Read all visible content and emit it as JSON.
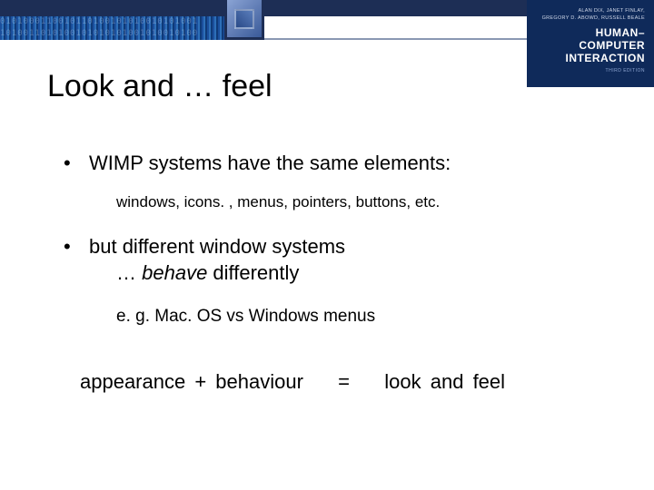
{
  "book": {
    "authors_line1": "ALAN DIX, JANET FINLAY,",
    "authors_line2": "GREGORY D. ABOWD, RUSSELL BEALE",
    "title_line1": "HUMAN–COMPUTER",
    "title_line2": "INTERACTION",
    "edition": "THIRD EDITION"
  },
  "slide": {
    "title": "Look and … feel",
    "bullet1": "WIMP systems have the same elements:",
    "bullet1_sub": "windows, icons. , menus, pointers, buttons, etc.",
    "bullet2": "but different window systems",
    "bullet2_line2_prefix": "… ",
    "bullet2_line2_emph": "behave",
    "bullet2_line2_suffix": " differently",
    "example": "e. g. Mac. OS vs Windows menus",
    "equation_left": "appearance + behaviour",
    "equation_eq": "=",
    "equation_right": "look and feel"
  }
}
